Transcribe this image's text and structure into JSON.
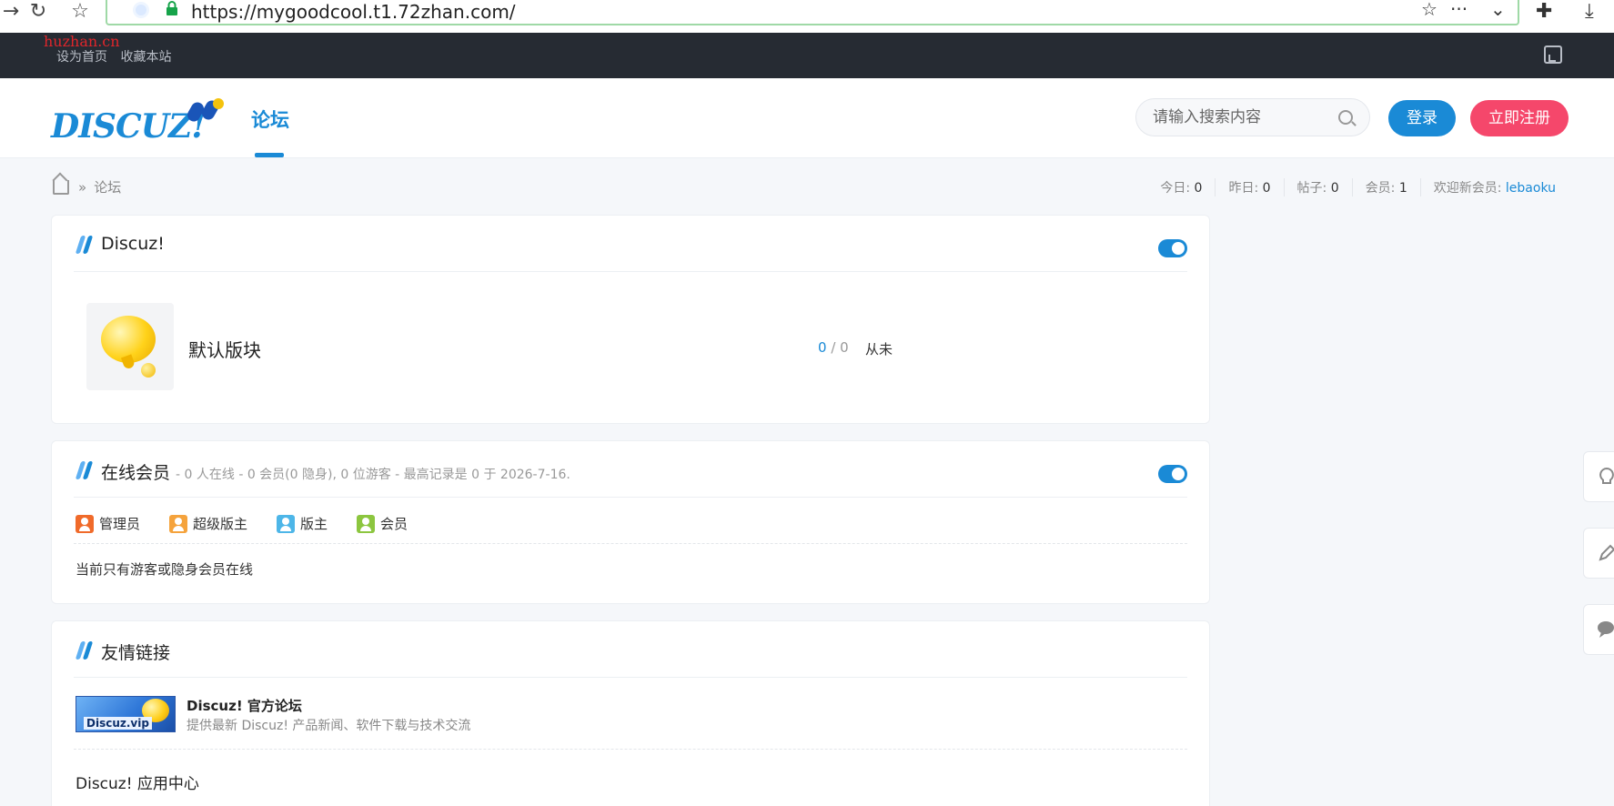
{
  "browser": {
    "url": "https://mygoodcool.t1.72zhan.com/",
    "back_glyph": "→",
    "reload_glyph": "↻",
    "favorites_glyph": "☆",
    "star_glyph": "☆",
    "more_glyph": "···",
    "chevron_glyph": "⌄",
    "extensions_glyph": "✚",
    "download_glyph": "⤓"
  },
  "topbar": {
    "watermark": "huzhan.cn",
    "set_home": "设为首页",
    "bookmark": "收藏本站"
  },
  "header": {
    "logo_text": "DISCUZ!",
    "nav_forum": "论坛",
    "search_placeholder": "请输入搜索内容",
    "login": "登录",
    "register": "立即注册"
  },
  "breadcrumb": {
    "sep": "»",
    "current": "论坛"
  },
  "stats": {
    "today_label": "今日:",
    "today": "0",
    "yesterday_label": "昨日:",
    "yesterday": "0",
    "posts_label": "帖子:",
    "posts": "0",
    "members_label": "会员:",
    "members": "1",
    "welcome_label": "欢迎新会员:",
    "newest_member": "lebaoku"
  },
  "category": {
    "title": "Discuz!",
    "forum_name": "默认版块",
    "threads": "0",
    "count_sep": "/",
    "posts": "0",
    "last_post": "从未"
  },
  "online": {
    "title": "在线会员",
    "summary": "- 0 人在线 - 0 会员(0 隐身), 0 位游客 - 最高记录是 0 于 2026-7-16.",
    "groups": [
      "管理员",
      "超级版主",
      "版主",
      "会员"
    ],
    "note": "当前只有游客或隐身会员在线"
  },
  "links": {
    "title": "友情链接",
    "banner_text": "Discuz.vip",
    "official_title": "Discuz! 官方论坛",
    "official_desc": "提供最新 Discuz! 产品新闻、软件下载与技术交流",
    "app_center": "Discuz! 应用中心"
  },
  "float_tools": [
    "lightbulb-icon",
    "edit-icon",
    "chat-icon"
  ],
  "colors": {
    "accent": "#1a8ad6",
    "register": "#f5476b",
    "topbar": "#262b33"
  }
}
